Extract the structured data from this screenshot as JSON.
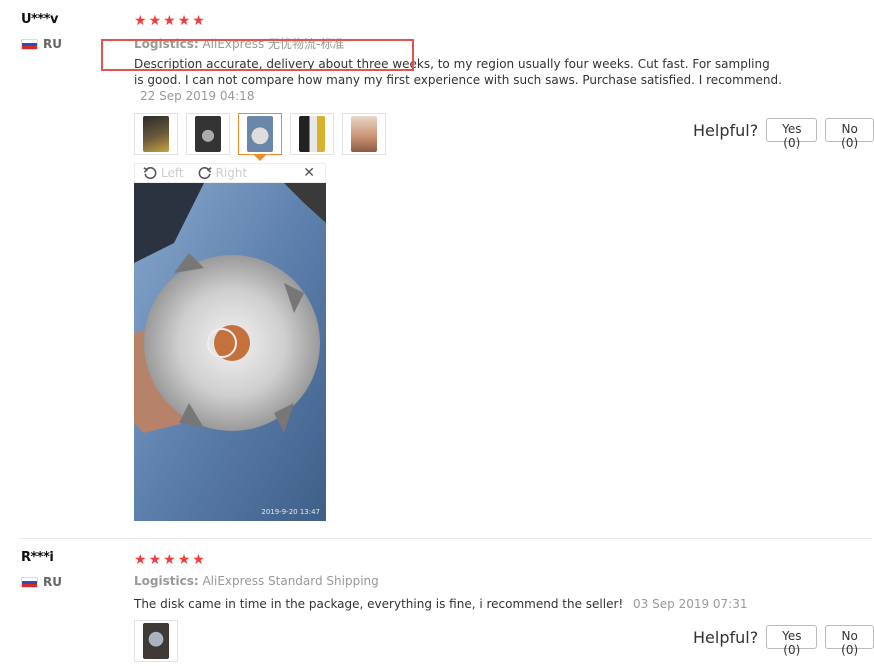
{
  "reviews": [
    {
      "user": "U***v",
      "country": "RU",
      "rating": 5,
      "logistics_label": "Logistics:",
      "logistics_value": "AliExpress 无忧物流-标准",
      "feedback": "Description accurate, delivery about three weeks, to my region usually four weeks. Cut fast. For sampling is good. I can not compare how many my first experience with such saws. Purchase satisfied. I recommend.",
      "date": "22 Sep 2019 04:18",
      "helpful_label": "Helpful?",
      "yes_label": "Yes (0)",
      "no_label": "No (0)",
      "thumbnails": [
        {
          "name": "thumb-photo-1",
          "color": "#6b5a3b"
        },
        {
          "name": "thumb-photo-2",
          "color": "#444444"
        },
        {
          "name": "thumb-photo-3",
          "color": "#b9a89a"
        },
        {
          "name": "thumb-photo-4",
          "color": "#d9b12a"
        },
        {
          "name": "thumb-photo-5",
          "color": "#c98f6f"
        }
      ],
      "active_thumbnail": 3,
      "viewer": {
        "left_label": "Left",
        "right_label": "Right",
        "close_icon": "close-icon",
        "photo_timestamp": "2019-9-20 13:47"
      }
    },
    {
      "user": "R***i",
      "country": "RU",
      "rating": 5,
      "logistics_label": "Logistics:",
      "logistics_value": "AliExpress Standard Shipping",
      "feedback": "The disk came in time in the package, everything is fine, i recommend the seller!",
      "date": "03 Sep 2019 07:31",
      "helpful_label": "Helpful?",
      "yes_label": "Yes (0)",
      "no_label": "No (0)",
      "thumbnails": [
        {
          "name": "thumb-photo-1",
          "color": "#3f3a35"
        }
      ]
    }
  ],
  "colors": {
    "star": "#f23c3c",
    "highlight": "#e0554f",
    "active_thumb": "#f08a2a"
  }
}
